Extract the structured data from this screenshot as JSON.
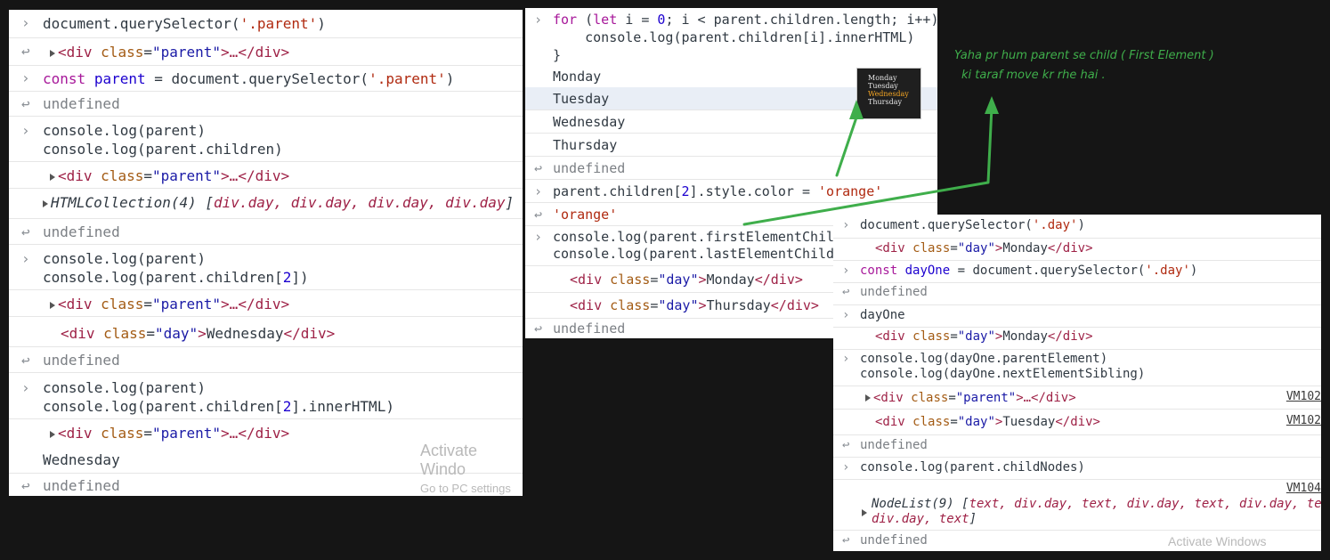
{
  "panel_left": {
    "lines": {
      "l1": "document.querySelector(",
      "l1s": "'.parent'",
      "l1e": ")",
      "l2_tag_open": "<div",
      "l2_attr": "class",
      "l2_val": "\"parent\"",
      "l2_rest": ">…</div>",
      "l3_kw": "const",
      "l3_name": "parent",
      "l3_mid": " = document.querySelector(",
      "l3_s": "'.parent'",
      "l3_e": ")",
      "undefined": "undefined",
      "l5a": "console.log(parent)",
      "l5b": "console.log(parent.children)",
      "collection_label": "HTMLCollection(4) [",
      "collection_items": "div.day, div.day, div.day, div.day",
      "collection_end": "]",
      "l8a": "console.log(parent)",
      "l8b_pre": "console.log(parent.children[",
      "l8b_n": "2",
      "l8b_post": "])",
      "day_val": "\"day\"",
      "wednesday": "Wednesday",
      "div_close": "</div>",
      "l11a": "console.log(parent)",
      "l11b_pre": "console.log(parent.children[",
      "l11b_n": "2",
      "l11b_post": "].innerHTML)",
      "wednesday_plain": "Wednesday"
    },
    "watermark": {
      "line1": "Activate Windo",
      "line2": "Go to PC settings to"
    }
  },
  "panel_mid": {
    "for_kw": "for",
    "for_1": " (",
    "let_kw": "let",
    "for_2": " i = ",
    "zero": "0",
    "for_3": "; i < parent.children.length; i++) {",
    "for_body": "    console.log(parent.children[i].innerHTML)",
    "for_close": "}",
    "days": [
      "Monday",
      "Tuesday",
      "Wednesday",
      "Thursday"
    ],
    "undefined": "undefined",
    "color_pre": "parent.children[",
    "color_n": "2",
    "color_post": "].style.color = ",
    "color_s": "'orange'",
    "orange_result": "'orange'",
    "first_child": "console.log(parent.firstElementChild)",
    "last_child": "console.log(parent.lastElementChild)",
    "monday_html": "Monday",
    "thursday_html": "Thursday",
    "thumb": [
      "Monday",
      "Tuesday",
      "Wednesday",
      "Thursday"
    ]
  },
  "panel_right": {
    "q1_pre": "document.querySelector(",
    "q1_s": "'.day'",
    "q1_e": ")",
    "monday": "Monday",
    "const_kw": "const",
    "dayone_name": "dayOne",
    "q2_mid": " = document.querySelector(",
    "q2_s": "'.day'",
    "q2_e": ")",
    "undefined": "undefined",
    "dayone": "dayOne",
    "log_parent_el": "console.log(dayOne.parentElement)",
    "log_next_sib": "console.log(dayOne.nextElementSibling)",
    "vm_a": "VM102",
    "vm_b": "VM102",
    "tuesday": "Tuesday",
    "child_nodes": "console.log(parent.childNodes)",
    "vm_c": "VM104",
    "nodelist_label": "NodeList(9) [",
    "nodelist_items_1": "text, div.day, text, div.day, text, div.day, text,",
    "nodelist_items_2": "div.day, text",
    "nodelist_end": "]",
    "watermark": "Activate Windows"
  },
  "annotation": {
    "line1": "Yaha pr hum parent se child ( First Element )",
    "line2": "ki taraf move kr rhe hai ."
  },
  "colors": {
    "arrow": "#3fae4b",
    "background": "#151515"
  }
}
